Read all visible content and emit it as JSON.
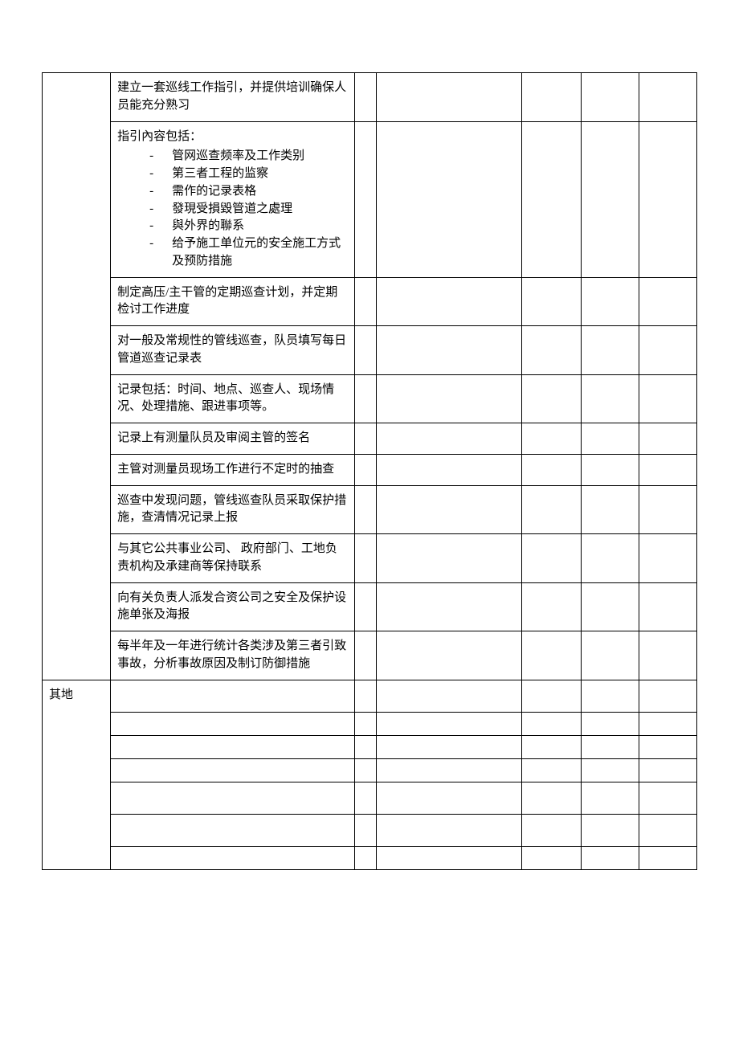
{
  "category": {
    "other": "其地"
  },
  "rows": [
    {
      "text": "建立一套巡线工作指引，并提供培训确保人员能充分熟习"
    },
    {
      "header": "指引內容包括：",
      "items": [
        "管网巡查频率及工作类别",
        "第三者工程的监察",
        "需作的记录表格",
        "發現受損毀管道之處理",
        "與外界的聯系",
        "给予施工单位元的安全施工方式及预防措施"
      ]
    },
    {
      "text": "制定高压/主干管的定期巡查计划，并定期检讨工作进度"
    },
    {
      "text": "对一般及常规性的管线巡查，队员填写每日管道巡查记录表"
    },
    {
      "text": "记录包括：时间、地点、巡查人、现场情况、处理措施、跟进事项等。"
    },
    {
      "text": "记录上有测量队员及审阅主管的签名"
    },
    {
      "text": "主管对测量员现场工作进行不定时的抽查"
    },
    {
      "text": "巡查中发现问题，管线巡查队员采取保护措施，查清情况记录上报"
    },
    {
      "text": "与其它公共事业公司、 政府部门、工地负责机构及承建商等保持联系"
    },
    {
      "text": "向有关负责人派发合资公司之安全及保护设施单张及海报"
    },
    {
      "text": "每半年及一年进行统计各类涉及第三者引致事故，分析事故原因及制订防御措施"
    }
  ],
  "emptyRows": 7
}
